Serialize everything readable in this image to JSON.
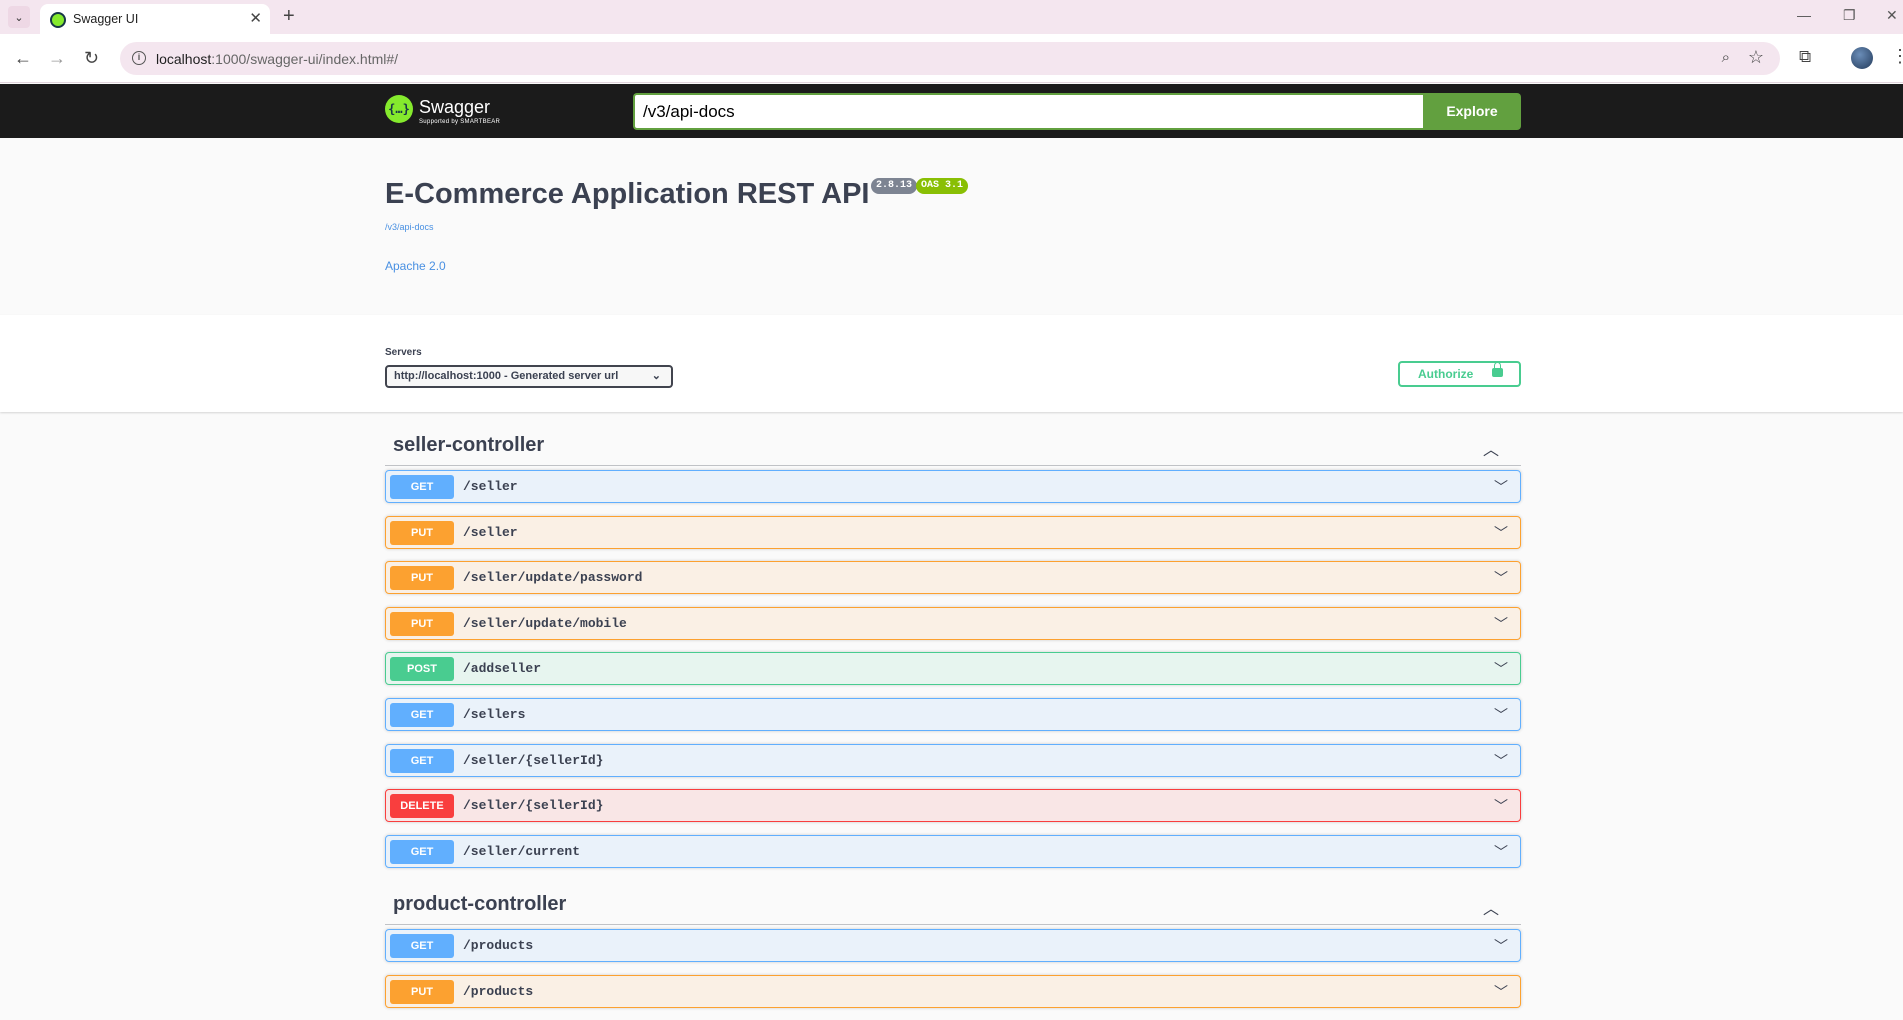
{
  "browser": {
    "tab_title": "Swagger UI",
    "url_host": "localhost",
    "url_rest": ":1000/swagger-ui/index.html#/"
  },
  "topbar": {
    "logo_text": "Swagger",
    "logo_sub": "Supported by SMARTBEAR",
    "spec_url": "/v3/api-docs",
    "explore_label": "Explore"
  },
  "info": {
    "title": "E-Commerce Application REST API",
    "version": "2.8.13",
    "oas": "OAS 3.1",
    "spec_link": "/v3/api-docs",
    "license": "Apache 2.0"
  },
  "schemes": {
    "servers_label": "Servers",
    "selected_server": "http://localhost:1000 - Generated server url",
    "authorize_label": "Authorize"
  },
  "tags": [
    {
      "name": "seller-controller",
      "operations": [
        {
          "method": "GET",
          "path": "/seller"
        },
        {
          "method": "PUT",
          "path": "/seller"
        },
        {
          "method": "PUT",
          "path": "/seller/update/password"
        },
        {
          "method": "PUT",
          "path": "/seller/update/mobile"
        },
        {
          "method": "POST",
          "path": "/addseller"
        },
        {
          "method": "GET",
          "path": "/sellers"
        },
        {
          "method": "GET",
          "path": "/seller/{sellerId}"
        },
        {
          "method": "DELETE",
          "path": "/seller/{sellerId}"
        },
        {
          "method": "GET",
          "path": "/seller/current"
        }
      ]
    },
    {
      "name": "product-controller",
      "operations": [
        {
          "method": "GET",
          "path": "/products"
        },
        {
          "method": "PUT",
          "path": "/products"
        }
      ]
    }
  ],
  "colors": {
    "get": "#61affe",
    "put": "#fca130",
    "post": "#49cc90",
    "delete": "#f93e3e",
    "explore": "#62a03f",
    "topbar": "#1b1b1b"
  }
}
